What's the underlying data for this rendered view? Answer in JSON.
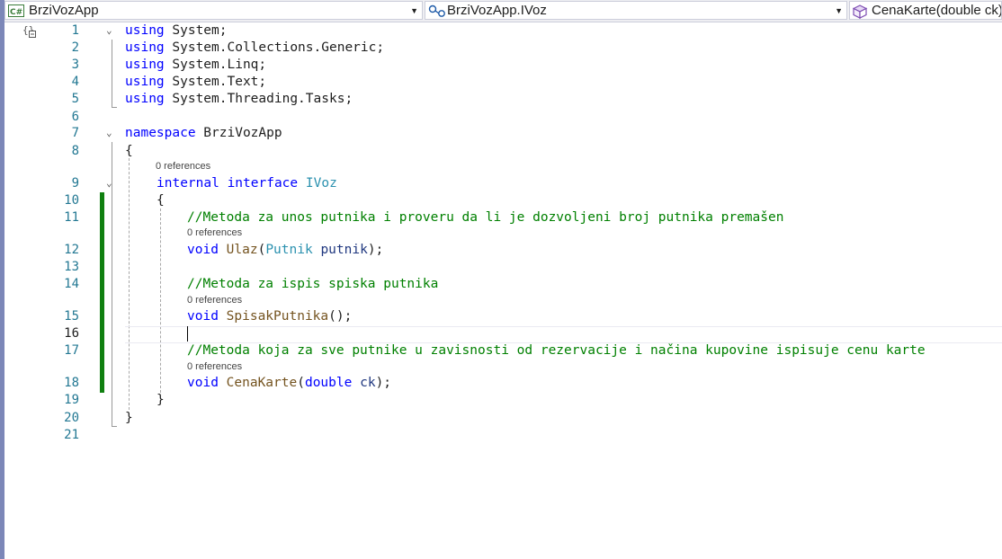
{
  "navbar": {
    "project": {
      "icon": "csharp-project-icon",
      "badge": "C#",
      "label": "BrziVozApp"
    },
    "type": {
      "icon": "interface-icon",
      "label": "BrziVozApp.IVoz"
    },
    "member": {
      "icon": "method-cube-icon",
      "label": "CenaKarte(double ck)"
    },
    "dropdown_glyph": "▼"
  },
  "editor": {
    "fold_glyph": "⌄",
    "current_line": 16,
    "lines": [
      {
        "n": "1"
      },
      {
        "n": "2"
      },
      {
        "n": "3"
      },
      {
        "n": "4"
      },
      {
        "n": "5"
      },
      {
        "n": "6"
      },
      {
        "n": "7"
      },
      {
        "n": "8"
      },
      {
        "n": "9"
      },
      {
        "n": "10"
      },
      {
        "n": "11"
      },
      {
        "n": "12"
      },
      {
        "n": "13"
      },
      {
        "n": "14"
      },
      {
        "n": "15"
      },
      {
        "n": "16"
      },
      {
        "n": "17"
      },
      {
        "n": "18"
      },
      {
        "n": "19"
      },
      {
        "n": "20"
      },
      {
        "n": "21"
      }
    ],
    "code": {
      "l1": {
        "kw": "using",
        "rest": " System;"
      },
      "l2": {
        "kw": "using",
        "rest": " System.Collections.Generic;"
      },
      "l3": {
        "kw": "using",
        "rest": " System.Linq;"
      },
      "l4": {
        "kw": "using",
        "rest": " System.Text;"
      },
      "l5": {
        "kw": "using",
        "rest": " System.Threading.Tasks;"
      },
      "l7": {
        "kw": "namespace",
        "rest": " BrziVozApp"
      },
      "l8": "{",
      "l9": {
        "kw1": "internal",
        "kw2": "interface",
        "type": "IVoz"
      },
      "l10": "{",
      "l11": "//Metoda za unos putnika i proveru da li je dozvoljeni broj putnika premašen",
      "l12": {
        "kw": "void",
        "fn": "Ulaz",
        "p1": "(",
        "type": "Putnik",
        "param": "putnik",
        "end": ");"
      },
      "l14": "//Metoda za ispis spiska putnika",
      "l15": {
        "kw": "void",
        "fn": "SpisakPutnika",
        "end": "();"
      },
      "l17": "//Metoda koja za sve putnike u zavisnosti od rezervacije i načina kupovine ispisuje cenu karte",
      "l18": {
        "kw": "void",
        "fn": "CenaKarte",
        "p1": "(",
        "type": "double",
        "param": "ck",
        "end": ");"
      },
      "l19": "}",
      "l20": "}"
    },
    "codelens": {
      "interface": "0 references",
      "ulaz": "0 references",
      "spisak": "0 references",
      "cena": "0 references"
    },
    "colors": {
      "change_bar": "#108010",
      "keyword": "#0000ff",
      "type": "#2b91af",
      "comment": "#008000",
      "method": "#74531f",
      "parameter": "#1f377f",
      "line_number": "#237893"
    }
  }
}
